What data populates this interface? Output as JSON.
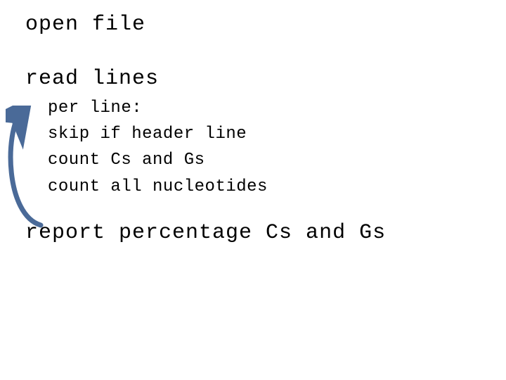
{
  "lines": {
    "open": "open file",
    "read": "read lines",
    "per": "per line:",
    "skip": "skip if header line",
    "countCG": "count Cs and Gs",
    "countAll": "count all nucleotides",
    "report": "report percentage Cs and Gs"
  },
  "arrowColor": "#4a6a98"
}
